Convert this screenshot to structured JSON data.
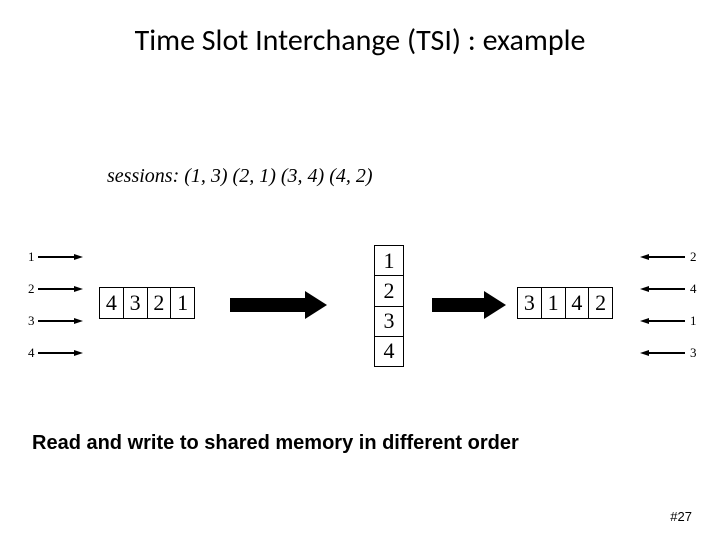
{
  "title": "Time Slot Interchange (TSI) : example",
  "sessions_prefix": "sessions: ",
  "sessions_pairs": "(1, 3) (2, 1) (3, 4) (4, 2)",
  "left_ports": [
    "1",
    "2",
    "3",
    "4"
  ],
  "right_ports": [
    "2",
    "4",
    "1",
    "3"
  ],
  "input_cells": [
    "4",
    "3",
    "2",
    "1"
  ],
  "memory_cells": [
    "1",
    "2",
    "3",
    "4"
  ],
  "output_cells": [
    "3",
    "1",
    "4",
    "2"
  ],
  "footnote": "Read and write to shared memory in different order",
  "pagenum": "#27"
}
